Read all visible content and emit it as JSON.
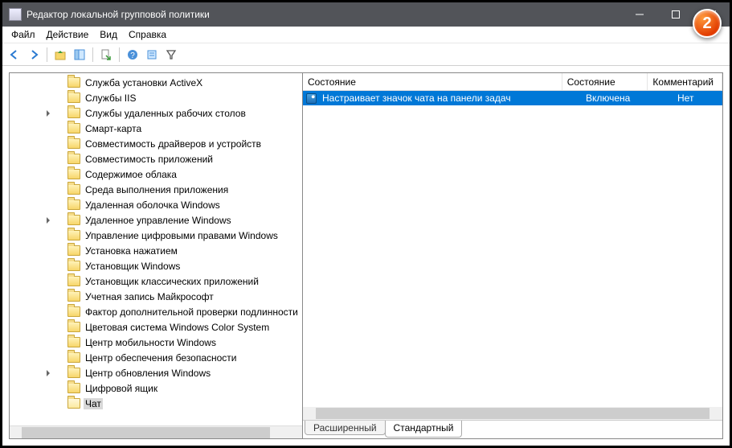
{
  "window": {
    "title": "Редактор локальной групповой политики"
  },
  "menu": {
    "file": "Файл",
    "action": "Действие",
    "view": "Вид",
    "help": "Справка"
  },
  "toolbar_icons": {
    "back": "back-arrow-icon",
    "forward": "forward-arrow-icon",
    "up": "up-folder-icon",
    "show_hide": "show-hide-tree-icon",
    "export": "export-list-icon",
    "help": "help-icon",
    "props": "properties-icon",
    "filter": "filter-icon"
  },
  "tree": {
    "items": [
      {
        "label": "Служба установки ActiveX",
        "expander": false
      },
      {
        "label": "Службы IIS",
        "expander": false
      },
      {
        "label": "Службы удаленных рабочих столов",
        "expander": true
      },
      {
        "label": "Смарт-карта",
        "expander": false
      },
      {
        "label": "Совместимость драйверов и устройств",
        "expander": false
      },
      {
        "label": "Совместимость приложений",
        "expander": false
      },
      {
        "label": "Содержимое облака",
        "expander": false
      },
      {
        "label": "Среда выполнения приложения",
        "expander": false
      },
      {
        "label": "Удаленная оболочка Windows",
        "expander": false
      },
      {
        "label": "Удаленное управление Windows",
        "expander": true
      },
      {
        "label": "Управление цифровыми правами Windows",
        "expander": false
      },
      {
        "label": "Установка нажатием",
        "expander": false
      },
      {
        "label": "Установщик Windows",
        "expander": false
      },
      {
        "label": "Установщик классических приложений",
        "expander": false
      },
      {
        "label": "Учетная запись Майкрософт",
        "expander": false
      },
      {
        "label": "Фактор дополнительной проверки подлинности",
        "expander": false
      },
      {
        "label": "Цветовая система Windows Color System",
        "expander": false
      },
      {
        "label": "Центр мобильности Windows",
        "expander": false
      },
      {
        "label": "Центр обеспечения безопасности",
        "expander": false
      },
      {
        "label": "Центр обновления Windows",
        "expander": true
      },
      {
        "label": "Цифровой ящик",
        "expander": false
      },
      {
        "label": "Чат",
        "expander": false,
        "selected": true,
        "open": true
      }
    ]
  },
  "list": {
    "columns": {
      "state": "Состояние",
      "enabled": "Состояние",
      "comment": "Комментарий"
    },
    "rows": [
      {
        "name": "Настраивает значок чата на панели задач",
        "state": "Включена",
        "comment": "Нет",
        "selected": true
      }
    ]
  },
  "tabs": {
    "extended": "Расширенный",
    "standard": "Стандартный"
  },
  "badge": "2"
}
